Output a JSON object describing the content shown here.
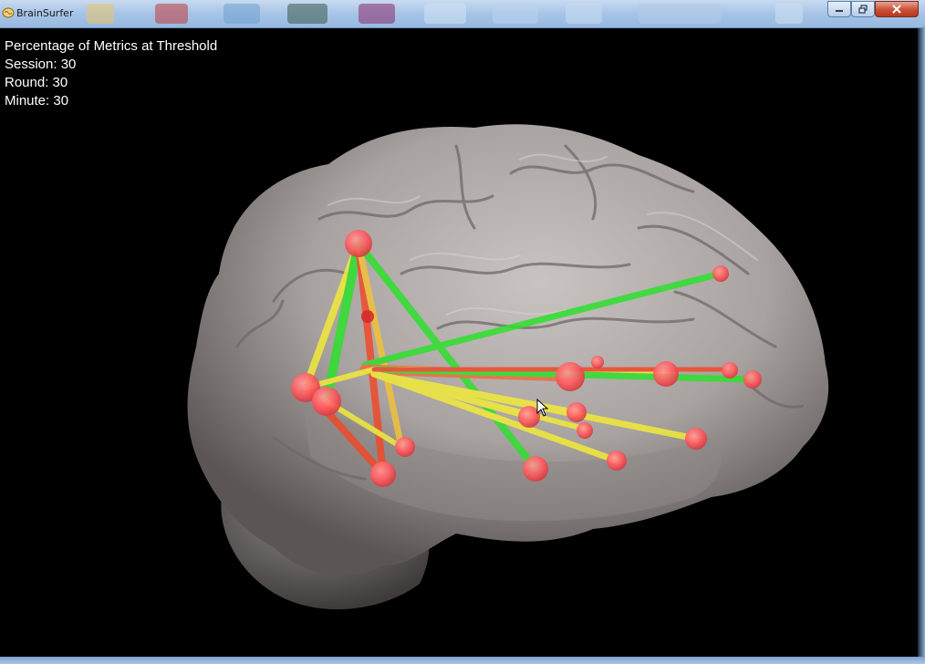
{
  "window": {
    "title": "BrainSurfer",
    "icons": {
      "app": "brain-app-icon",
      "minimize": "minimize-icon",
      "maximize": "maximize-icon",
      "close": "close-icon"
    }
  },
  "overlay": {
    "heading": "Percentage of Metrics at Threshold",
    "session": "Session: 30",
    "round": "Round: 30",
    "minute": "Minute: 30"
  },
  "colors": {
    "background": "#000000",
    "node": "#ff5a5f",
    "edge_green": "#2ee02e",
    "edge_yellow": "#f2ea3a",
    "edge_red": "#f04a2a",
    "brain_surface": "#a39d9b"
  }
}
